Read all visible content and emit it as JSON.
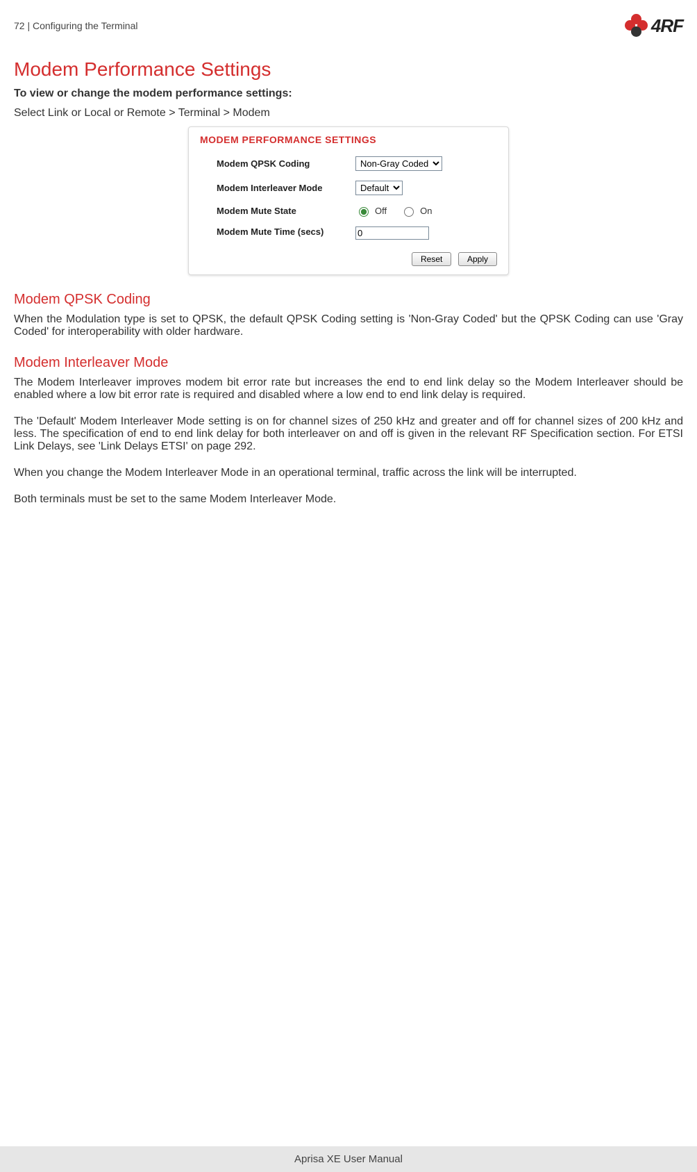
{
  "header": {
    "page_number": "72",
    "section": "Configuring the Terminal",
    "logo_text": "4RF"
  },
  "title": "Modem Performance Settings",
  "intro_bold": "To view or change the modem performance settings:",
  "intro_nav": "Select Link or Local or Remote > Terminal > Modem",
  "panel": {
    "header": "MODEM PERFORMANCE SETTINGS",
    "rows": {
      "qpsk_label": "Modem QPSK Coding",
      "qpsk_value": "Non-Gray Coded",
      "interleaver_label": "Modem Interleaver Mode",
      "interleaver_value": "Default",
      "mute_state_label": "Modem Mute State",
      "mute_off": "Off",
      "mute_on": "On",
      "mute_time_label": "Modem Mute Time (secs)",
      "mute_time_value": "0"
    },
    "buttons": {
      "reset": "Reset",
      "apply": "Apply"
    }
  },
  "sec1": {
    "heading": "Modem QPSK Coding",
    "p1": "When the Modulation type is set to QPSK, the default QPSK Coding setting is 'Non-Gray Coded' but the QPSK Coding can use 'Gray Coded' for interoperability with older hardware."
  },
  "sec2": {
    "heading": "Modem Interleaver Mode",
    "p1": "The Modem Interleaver improves modem bit error rate but increases the end to end link delay so the Modem Interleaver should be enabled where a low bit error rate is required and disabled where a low end to end link delay is required.",
    "p2": "The 'Default' Modem Interleaver Mode setting is on for channel sizes of 250 kHz and greater and off for channel sizes of 200 kHz and less. The specification of end to end link delay for both interleaver on and off is given in the relevant RF Specification section. For ETSI Link Delays, see 'Link Delays ETSI' on page 292.",
    "p3": "When you change the Modem Interleaver Mode in an operational terminal, traffic across the link will be interrupted.",
    "p4": "Both terminals must be set to the same Modem Interleaver Mode."
  },
  "footer": "Aprisa XE User Manual"
}
